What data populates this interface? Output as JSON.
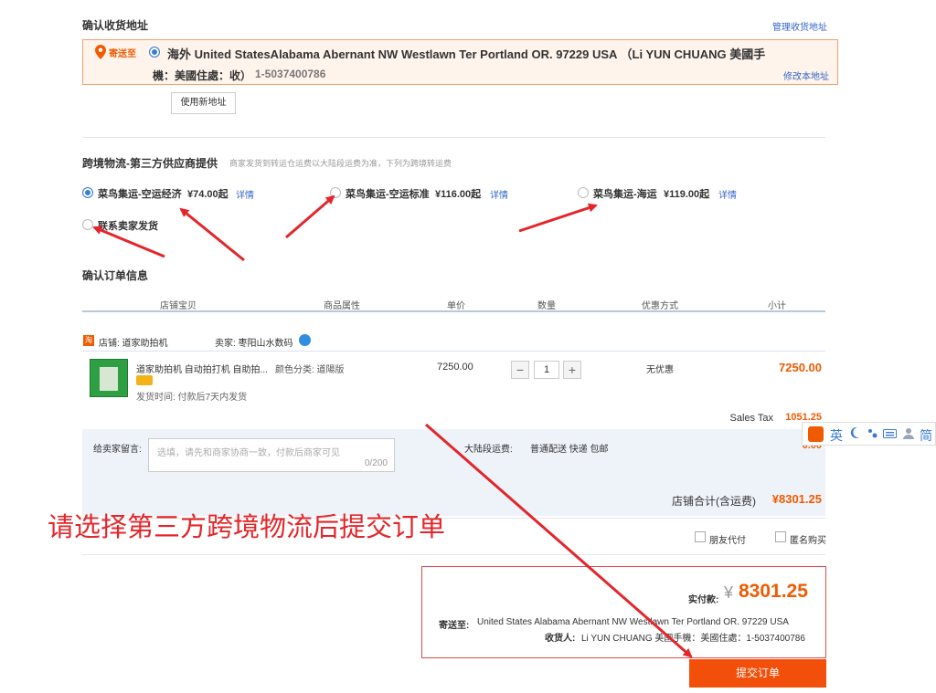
{
  "address": {
    "section_title": "确认收货地址",
    "manage_link": "管理收货地址",
    "ship_to_badge": "寄送至",
    "line1": "海外 United StatesAlabama Abernant NW Westlawn Ter Portland OR. 97229 USA （Li YUN CHUANG 美國手",
    "line2_prefix": "機：美國住處：收）",
    "line2_phone": "1-5037400786",
    "edit_link": "修改本地址",
    "new_address_button": "使用新地址"
  },
  "logistics": {
    "title": "跨境物流-第三方供应商提供",
    "note": "商家发货到转运仓运费以大陆段运费为准，下列为跨境转运费",
    "options": [
      {
        "name": "菜鸟集运-空运经济",
        "price": "¥74.00起",
        "detail": "详情",
        "selected": true
      },
      {
        "name": "菜鸟集运-空运标准",
        "price": "¥116.00起",
        "detail": "详情",
        "selected": false
      },
      {
        "name": "菜鸟集运-海运",
        "price": "¥119.00起",
        "detail": "详情",
        "selected": false
      },
      {
        "name": "联系卖家发货",
        "price": "",
        "detail": "",
        "selected": false
      }
    ]
  },
  "order": {
    "title": "确认订单信息",
    "columns": [
      "店铺宝贝",
      "商品属性",
      "单价",
      "数量",
      "优惠方式",
      "小计"
    ],
    "shop_label": "店铺: 道家助拍机",
    "seller_label": "卖家: 枣阳山水数码",
    "item": {
      "name": "道家助拍机 自动拍打机 自助拍...",
      "shipping_time": "发货时间: 付款后7天内发货",
      "attribute": "颜色分类: 道陽版",
      "unit_price": "7250.00",
      "quantity": "1",
      "discount": "无优惠",
      "subtotal": "7250.00"
    },
    "sales_tax_label": "Sales Tax",
    "sales_tax_value": "1051.25",
    "message_label": "给卖家留言:",
    "message_placeholder": "选填，请先和商家协商一致，付款后商家可见",
    "message_counter": "0/200",
    "domestic_fee_label": "大陆段运费:",
    "domestic_fee_method": "普通配送 快递 包邮",
    "domestic_fee_value": "0.00",
    "shop_total_label": "店铺合计(含运费)",
    "shop_total_value": "¥8301.25",
    "friend_pay": "朋友代付",
    "anonymous": "匿名购买"
  },
  "payment": {
    "actual_label": "实付款:",
    "currency": "¥",
    "amount": "8301.25",
    "ship_to_label": "寄送至:",
    "ship_to_value": "United States Alabama Abernant NW Westlawn Ter Portland OR. 97229 USA",
    "receiver_label": "收货人:",
    "receiver_value": "Li YUN CHUANG 美國手機：美國住處：1-5037400786",
    "submit_button": "提交订单"
  },
  "annotation_text": "请选择第三方跨境物流后提交订单",
  "ime": {
    "mode": "英",
    "lang": "简"
  },
  "colors": {
    "accent": "#f24f0a",
    "annotation": "#e3262b",
    "link": "#3366cc"
  }
}
